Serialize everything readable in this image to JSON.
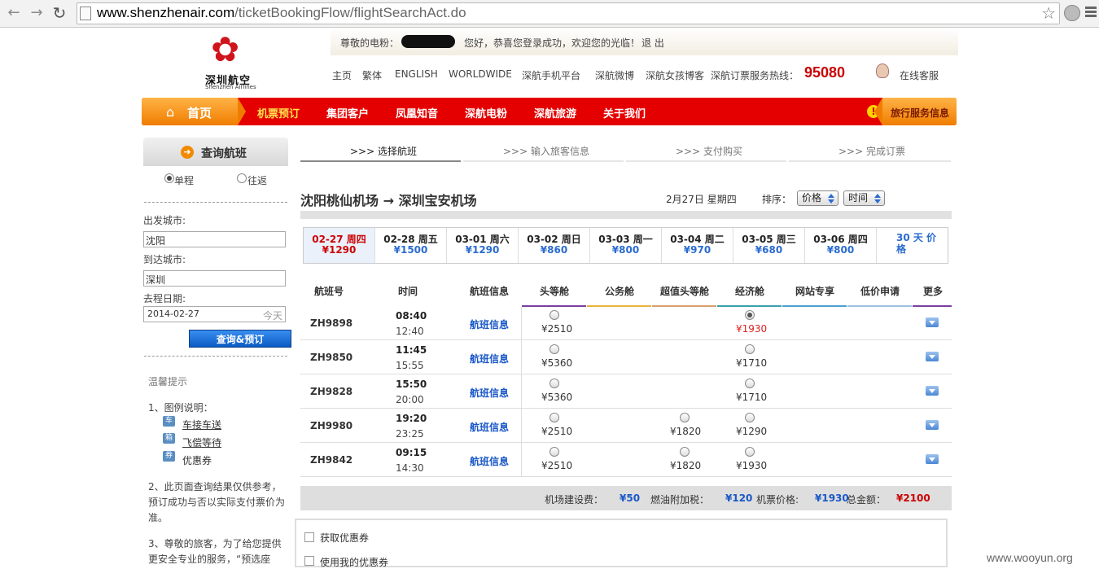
{
  "browser": {
    "url_host": "www.shenzhenair.com",
    "url_path": "/ticketBookingFlow/flightSearchAct.do"
  },
  "header": {
    "logo_cn": "深圳航空",
    "logo_en": "Shenzhen Airlines",
    "greet_label": "尊敬的电粉：",
    "greet_msg": "您好，恭喜您登录成功，欢迎您的光临！",
    "logout": "退 出",
    "links": [
      "主页",
      "繁体",
      "ENGLISH",
      "WORLDWIDE",
      "深航手机平台",
      "深航微博",
      "深航女孩博客"
    ],
    "hotline_label": "深航订票服务热线：",
    "hotline_num": "95080",
    "online_service": "在线客服"
  },
  "mainnav": {
    "home": "首页",
    "items": [
      "机票预订",
      "集团客户",
      "凤凰知音",
      "深航电粉",
      "深航旅游",
      "关于我们"
    ],
    "travel_info": "旅行服务信息"
  },
  "sidebar": {
    "title": "查询航班",
    "trip_oneway": "单程",
    "trip_round": "往返",
    "from_label": "出发城市:",
    "from_value": "沈阳",
    "to_label": "到达城市:",
    "to_value": "深圳",
    "date_label": "去程日期:",
    "date_value": "2014-02-27",
    "date_today": "今天",
    "search_btn": "查询&预订",
    "tips_title": "温馨提示",
    "tip1": "1、图例说明：",
    "legend": [
      {
        "icon": "车",
        "label": "车接车送"
      },
      {
        "icon": "箱",
        "label": "飞偿等待"
      },
      {
        "icon": "券",
        "label": "优惠券"
      }
    ],
    "tip2": "2、此页面查询结果仅供参考，预订成功与否以实际支付票价为准。",
    "tip3": "3、尊敬的旅客，为了给您提供更安全专业的服务，“预选座"
  },
  "steps": [
    ">>> 选择航班",
    ">>> 输入旅客信息",
    ">>> 支付购买",
    ">>> 完成订票"
  ],
  "route": {
    "from": "沈阳桃仙机场",
    "arrow": "→",
    "to": "深圳宝安机场",
    "date": "2月27日 星期四",
    "sort_label": "排序：",
    "sort_price": "价格",
    "sort_time": "时间"
  },
  "date_strip": [
    {
      "date": "02-27 周四",
      "price": "¥1290"
    },
    {
      "date": "02-28 周五",
      "price": "¥1500"
    },
    {
      "date": "03-01 周六",
      "price": "¥1290"
    },
    {
      "date": "03-02 周日",
      "price": "¥860"
    },
    {
      "date": "03-03 周一",
      "price": "¥800"
    },
    {
      "date": "03-04 周二",
      "price": "¥970"
    },
    {
      "date": "03-05 周三",
      "price": "¥680"
    },
    {
      "date": "03-06 周四",
      "price": "¥800"
    }
  ],
  "date_30": "30 天 价 格",
  "table": {
    "headers": [
      "航班号",
      "时间",
      "航班信息",
      "头等舱",
      "公务舱",
      "超值头等舱",
      "经济舱",
      "网站专享",
      "低价申请",
      "更多"
    ],
    "info_label": "航班信息",
    "rows": [
      {
        "flight": "ZH9898",
        "dep": "08:40",
        "arr": "12:40",
        "first": "¥2510",
        "super": "",
        "eco": "¥1930",
        "eco_selected": true
      },
      {
        "flight": "ZH9850",
        "dep": "11:45",
        "arr": "15:55",
        "first": "¥5360",
        "super": "",
        "eco": "¥1710",
        "eco_selected": false
      },
      {
        "flight": "ZH9828",
        "dep": "15:50",
        "arr": "20:00",
        "first": "¥5360",
        "super": "",
        "eco": "¥1710",
        "eco_selected": false
      },
      {
        "flight": "ZH9980",
        "dep": "19:20",
        "arr": "23:25",
        "first": "¥2510",
        "super": "¥1820",
        "eco": "¥1290",
        "eco_selected": false
      },
      {
        "flight": "ZH9842",
        "dep": "09:15",
        "arr": "14:30",
        "first": "¥2510",
        "super": "¥1820",
        "eco": "¥1930",
        "eco_selected": false
      }
    ]
  },
  "summary": {
    "airport_fee_label": "机场建设费：",
    "airport_fee": "¥50",
    "fuel_label": "燃油附加税：",
    "fuel": "¥120",
    "ticket_label": "机票价格:",
    "ticket": "¥1930",
    "total_label": "总金额：",
    "total": "¥2100"
  },
  "coupons": {
    "get": "获取优惠券",
    "use": "使用我的优惠券"
  },
  "watermark": "www.wooyun.org",
  "colors": {
    "nav_red": "#e40000",
    "nav_orange": "#f07d00",
    "price_blue": "#1a58c8",
    "price_red": "#cc0000"
  }
}
